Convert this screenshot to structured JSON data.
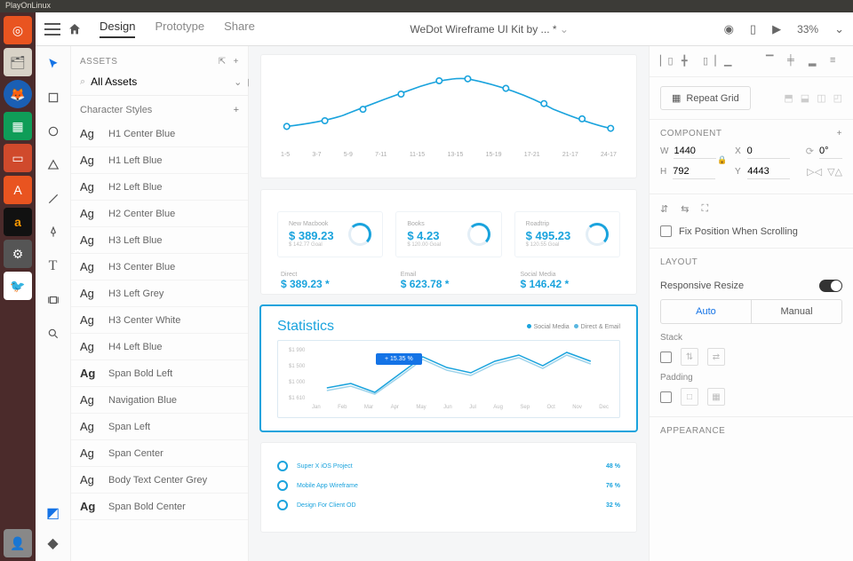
{
  "window": {
    "title": "PlayOnLinux"
  },
  "topbar": {
    "tabs": [
      "Design",
      "Prototype",
      "Share"
    ],
    "active_tab": 0,
    "doc_title": "WeDot Wireframe UI Kit by ... *",
    "zoom": "33%"
  },
  "assets": {
    "head_label": "ASSETS",
    "search_value": "All Assets",
    "char_styles_label": "Character Styles",
    "styles": [
      {
        "ag": "Ag",
        "bold": false,
        "name": "H1 Center Blue"
      },
      {
        "ag": "Ag",
        "bold": false,
        "name": "H1 Left Blue"
      },
      {
        "ag": "Ag",
        "bold": false,
        "name": "H2 Left Blue"
      },
      {
        "ag": "Ag",
        "bold": false,
        "name": "H2 Center Blue"
      },
      {
        "ag": "Ag",
        "bold": false,
        "name": "H3 Left Blue"
      },
      {
        "ag": "Ag",
        "bold": false,
        "name": "H3 Center Blue"
      },
      {
        "ag": "Ag",
        "bold": false,
        "name": "H3 Left Grey"
      },
      {
        "ag": "Ag",
        "bold": false,
        "name": "H3 Center White"
      },
      {
        "ag": "Ag",
        "bold": false,
        "name": "H4 Left Blue"
      },
      {
        "ag": "Ag",
        "bold": true,
        "name": "Span Bold Left"
      },
      {
        "ag": "Ag",
        "bold": false,
        "name": "Navigation Blue"
      },
      {
        "ag": "Ag",
        "bold": false,
        "name": "Span Left"
      },
      {
        "ag": "Ag",
        "bold": false,
        "name": "Span Center"
      },
      {
        "ag": "Ag",
        "bold": false,
        "name": "Body Text Center Grey"
      },
      {
        "ag": "Ag",
        "bold": true,
        "name": "Span Bold Center"
      }
    ]
  },
  "canvas": {
    "curve_labels": [
      "1-5",
      "3-7",
      "5-9",
      "7-11",
      "11-15",
      "13-15",
      "15-19",
      "17-21",
      "21-17",
      "24-17"
    ],
    "cards": [
      {
        "label": "New Macbook",
        "value": "$ 389.23",
        "sub": "$ 142.77 Goal"
      },
      {
        "label": "Books",
        "value": "$ 4.23",
        "sub": "$ 120.00 Goal"
      },
      {
        "label": "Roadtrip",
        "value": "$ 495.23",
        "sub": "$ 120.55 Goal"
      }
    ],
    "mini": [
      {
        "label": "Direct",
        "value": "$ 389.23 *"
      },
      {
        "label": "Email",
        "value": "$ 623.78 *"
      },
      {
        "label": "Social Media",
        "value": "$ 146.42 *"
      }
    ],
    "stats_title": "Statistics",
    "legend": [
      "Social Media",
      "Direct & Email"
    ],
    "tooltip": "+ 15.35 %",
    "y_ticks": [
      "$1 990",
      "$1 500",
      "$1 000",
      "$1 610"
    ],
    "x_ticks": [
      "Jan",
      "Feb",
      "Mar",
      "Apr",
      "May",
      "Jun",
      "Jul",
      "Aug",
      "Sep",
      "Oct",
      "Nov",
      "Dec"
    ],
    "progress": [
      {
        "name": "Super X iOS Project",
        "pct": "48 %"
      },
      {
        "name": "Mobile App Wireframe",
        "pct": "76 %"
      },
      {
        "name": "Design For Client OD",
        "pct": "32 %"
      }
    ]
  },
  "inspector": {
    "repeat_label": "Repeat Grid",
    "component_label": "COMPONENT",
    "w": "1440",
    "x": "0",
    "rot": "0°",
    "h": "792",
    "y": "4443",
    "fix_label": "Fix Position When Scrolling",
    "layout_label": "LAYOUT",
    "resp_label": "Responsive Resize",
    "seg": [
      "Auto",
      "Manual"
    ],
    "stack_label": "Stack",
    "padding_label": "Padding",
    "appearance_label": "APPEARANCE"
  },
  "chart_data": [
    {
      "type": "line",
      "title": "",
      "x": [
        "1-5",
        "3-7",
        "5-9",
        "7-11",
        "11-15",
        "13-15",
        "15-19",
        "17-21",
        "21-17",
        "24-17"
      ],
      "values": [
        28,
        34,
        52,
        70,
        80,
        80,
        72,
        58,
        40,
        30
      ],
      "ylim": [
        0,
        100
      ]
    },
    {
      "type": "line",
      "title": "Statistics",
      "x": [
        "Jan",
        "Feb",
        "Mar",
        "Apr",
        "May",
        "Jun",
        "Jul",
        "Aug",
        "Sep",
        "Oct",
        "Nov",
        "Dec"
      ],
      "series": [
        {
          "name": "Social Media",
          "values": [
            1100,
            1150,
            1050,
            1300,
            1550,
            1400,
            1350,
            1500,
            1650,
            1500,
            1750,
            1600
          ]
        },
        {
          "name": "Direct & Email",
          "values": [
            1050,
            1100,
            1000,
            1250,
            1500,
            1350,
            1300,
            1450,
            1600,
            1450,
            1700,
            1550
          ]
        }
      ],
      "ylim": [
        1000,
        1990
      ],
      "ylabel": "$"
    }
  ]
}
